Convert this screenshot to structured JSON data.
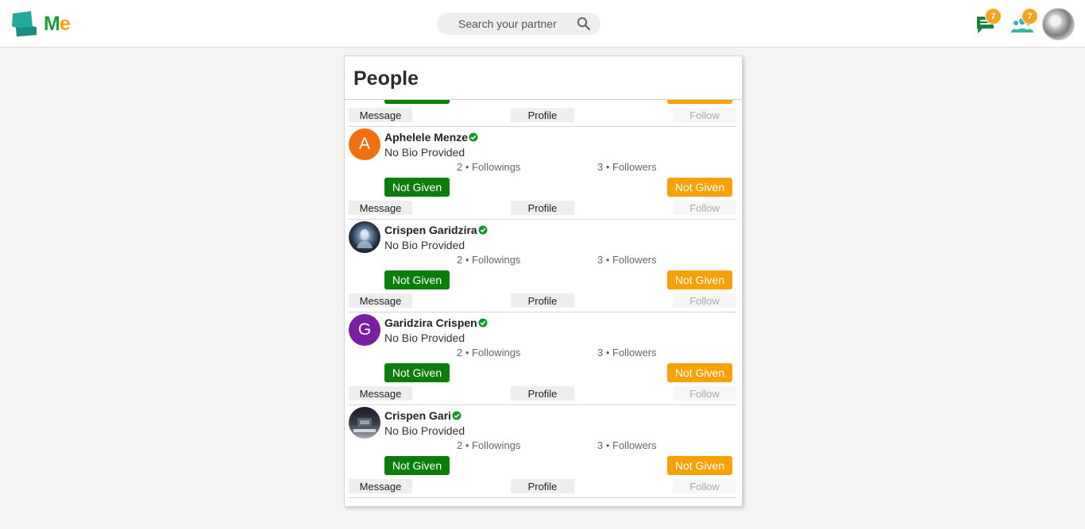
{
  "header": {
    "logo_letters": {
      "m": "M",
      "e": "e"
    },
    "search": {
      "placeholder": "Search your partner",
      "icon": "search-icon"
    },
    "messages": {
      "icon": "chat-icon",
      "badge": "7"
    },
    "friends": {
      "icon": "people-icon",
      "badge": "7"
    },
    "colors": {
      "brand_green": "#1c9b3a",
      "brand_orange": "#f5a10b",
      "badge": "#f4a51c"
    }
  },
  "people_panel": {
    "title": "People",
    "people": [
      {
        "name": "",
        "bio": "",
        "followings": "",
        "followers": "",
        "status_left": "",
        "status_right": "",
        "message": "Message",
        "profile": "Profile",
        "follow": "Follow"
      },
      {
        "name": "Aphelele Menze",
        "avatar_letter": "A",
        "avatar_color": "#f07010",
        "bio": "No Bio Provided",
        "followings": "2 • Followings",
        "followers": "3 • Followers",
        "status_left": "Not Given",
        "status_right": "Not Given",
        "message": "Message",
        "profile": "Profile",
        "follow": "Follow"
      },
      {
        "name": "Crispen Garidzira",
        "avatar_letter": "",
        "avatar_color": "#1d2a3a",
        "bio": "No Bio Provided",
        "followings": "2 • Followings",
        "followers": "3 • Followers",
        "status_left": "Not Given",
        "status_right": "Not Given",
        "message": "Message",
        "profile": "Profile",
        "follow": "Follow"
      },
      {
        "name": "Garidzira Crispen",
        "avatar_letter": "G",
        "avatar_color": "#7b1fa2",
        "bio": "No Bio Provided",
        "followings": "2 • Followings",
        "followers": "3 • Followers",
        "status_left": "Not Given",
        "status_right": "Not Given",
        "message": "Message",
        "profile": "Profile",
        "follow": "Follow"
      },
      {
        "name": "Crispen Gari",
        "avatar_letter": "",
        "avatar_color": "#2a2e38",
        "bio": "No Bio Provided",
        "followings": "2 • Followings",
        "followers": "3 • Followers",
        "status_left": "Not Given",
        "status_right": "Not Given",
        "message": "Message",
        "profile": "Profile",
        "follow": "Follow"
      }
    ],
    "colors": {
      "status_green": "#0a7d0a",
      "status_orange": "#f7a106",
      "verified": "#12962a"
    }
  }
}
